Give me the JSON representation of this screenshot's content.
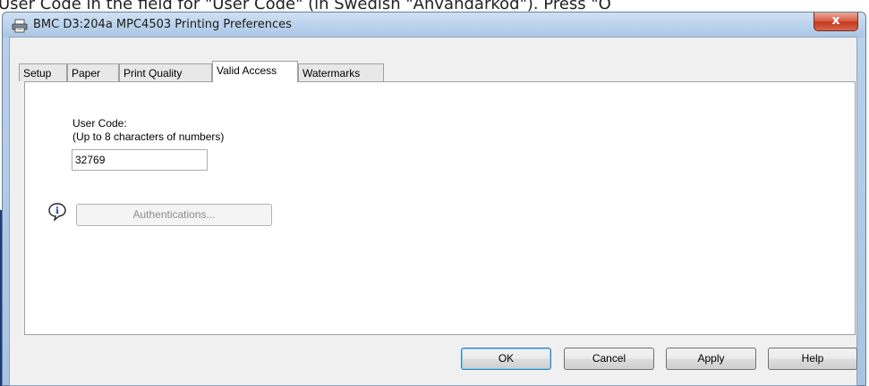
{
  "background": {
    "text": "User Code in the field for \"User Code\" (in Swedish \"Anvandarkod\"). Press \"O"
  },
  "window": {
    "title": "BMC D3:204a MPC4503 Printing Preferences",
    "close_label": "x"
  },
  "tabs": [
    {
      "label": "Setup"
    },
    {
      "label": "Paper"
    },
    {
      "label": "Print Quality"
    },
    {
      "label": "Valid Access",
      "active": true
    },
    {
      "label": "Watermarks"
    }
  ],
  "panel": {
    "user_code_label": "User Code:",
    "user_code_hint": "(Up to 8 characters of numbers)",
    "user_code_value": "32769",
    "authentications_label": "Authentications..."
  },
  "buttons": {
    "ok": "OK",
    "cancel": "Cancel",
    "apply": "Apply",
    "help": "Help"
  },
  "colors": {
    "title_bar": "#bcd3ec",
    "close_button": "#c5391b",
    "panel_bg": "#ffffff",
    "dialog_bg": "#f0f0f0"
  }
}
